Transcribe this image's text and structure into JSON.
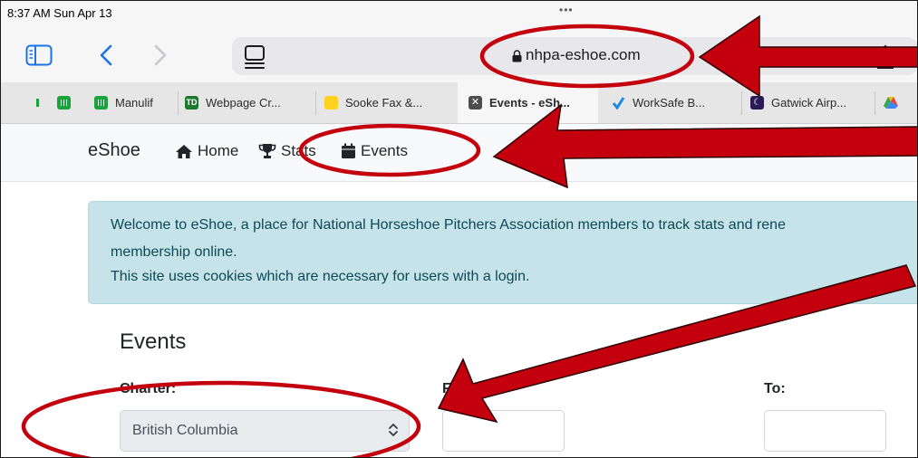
{
  "status_bar": {
    "time": "8:37 AM  Sun Apr 13",
    "dots": "•••"
  },
  "toolbar": {
    "url": "nhpa-eshoe.com"
  },
  "tabs": [
    {
      "label": ""
    },
    {
      "label": ""
    },
    {
      "label": "Manulif"
    },
    {
      "label": "Webpage Cr..."
    },
    {
      "label": "Sooke Fax &..."
    },
    {
      "label": "Events - eSh..."
    },
    {
      "label": "WorkSafe B..."
    },
    {
      "label": "Gatwick Airp..."
    },
    {
      "label": ""
    }
  ],
  "site": {
    "brand": "eShoe",
    "nav": [
      {
        "label": "Home",
        "icon": "home-icon"
      },
      {
        "label": "Stats",
        "icon": "trophy-icon"
      },
      {
        "label": "Events",
        "icon": "calendar-icon"
      }
    ],
    "alert": {
      "line1": "Welcome to eShoe, a place for National Horseshoe Pitchers Association members to track stats and rene",
      "line2": "membership online.",
      "line3": "This site uses cookies which are necessary for users with a login."
    },
    "events": {
      "title": "Events",
      "charter_label": "Charter:",
      "charter_value": "British Columbia",
      "from_label": "Fro",
      "to_label": "To:"
    }
  },
  "colors": {
    "annotation_red": "#c4000e",
    "alert_bg": "#c5e3e8",
    "alert_text": "#0c4a55"
  }
}
